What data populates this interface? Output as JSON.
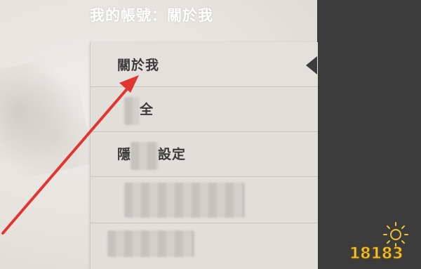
{
  "header": {
    "account_title": "我的帳號：關於我"
  },
  "menu": {
    "items": [
      {
        "label": "關於我",
        "selected": true
      },
      {
        "label": "全",
        "selected": false
      },
      {
        "label": "設定",
        "selected": false
      },
      {
        "label": "",
        "selected": false
      },
      {
        "label": "",
        "selected": false
      }
    ]
  },
  "watermark": {
    "text": "18183"
  },
  "colors": {
    "panel": "#e2dfdb",
    "dark_side": "#3c3c3c",
    "arrow": "#e0362f",
    "watermark": "#f1c232"
  }
}
